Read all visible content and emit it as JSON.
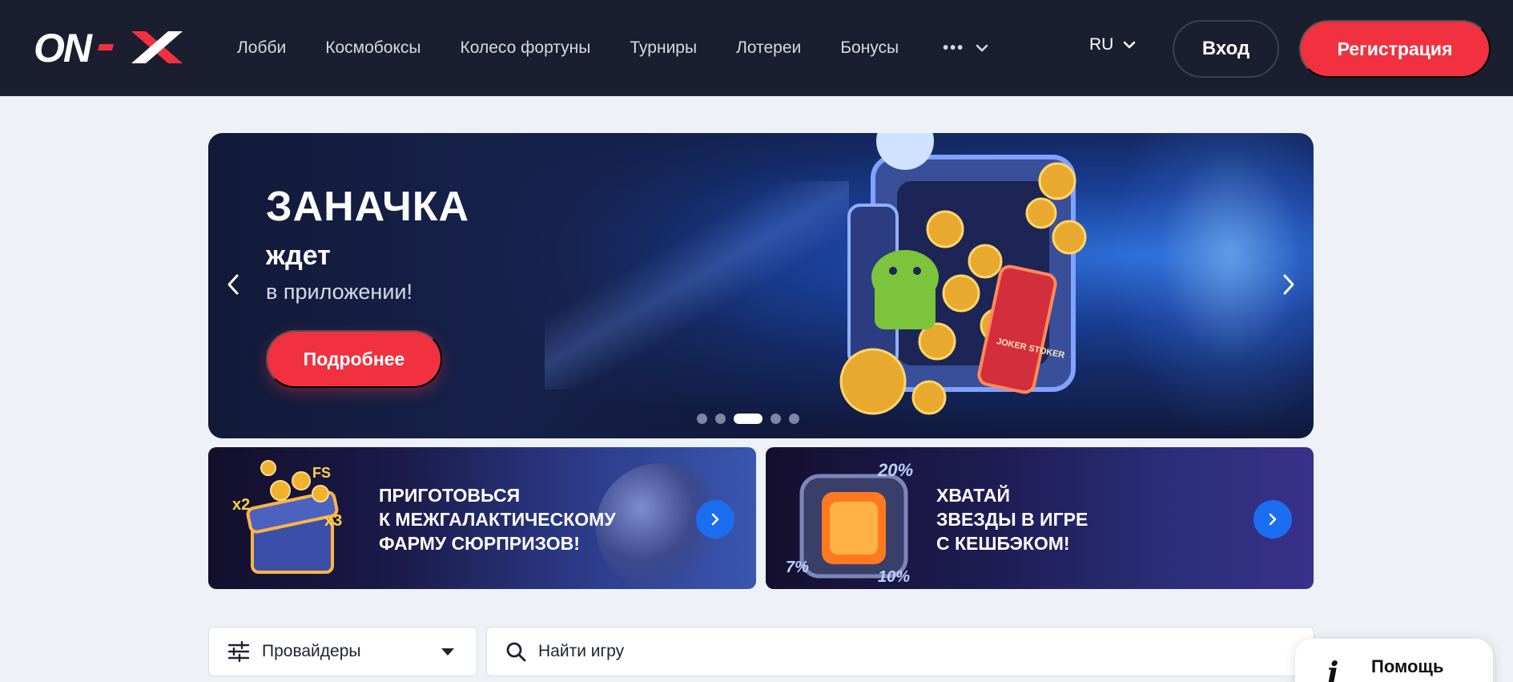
{
  "brand": {
    "logo_text": "ON-X",
    "accent": "#f1313f",
    "header_bg": "#1b1e2e"
  },
  "nav": {
    "items": [
      {
        "label": "Лобби"
      },
      {
        "label": "Космобоксы"
      },
      {
        "label": "Колесо фортуны"
      },
      {
        "label": "Турниры"
      },
      {
        "label": "Лотереи"
      },
      {
        "label": "Бонусы"
      }
    ],
    "more_icon": "more-dots-icon"
  },
  "lang": {
    "selected": "RU"
  },
  "auth": {
    "login_label": "Вход",
    "register_label": "Регистрация"
  },
  "hero": {
    "title": "ЗАНАЧКА",
    "subtitle": "ждет",
    "subtitle2": "в приложении!",
    "cta_label": "Подробнее",
    "phone_text": "JOKER STOKER",
    "slides_count": 5,
    "active_slide": 3
  },
  "promos": [
    {
      "text": "ПРИГОТОВЬСЯ К МЕЖГАЛАКТИЧЕСКОМУ ФАРМУ СЮРПРИЗОВ!",
      "lines": [
        "ПРИГОТОВЬСЯ",
        "К МЕЖГАЛАКТИЧЕСКОМУ",
        "ФАРМУ СЮРПРИЗОВ!"
      ],
      "badges": [
        "x2",
        "FS",
        "x3"
      ]
    },
    {
      "text": "ХВАТАЙ ЗВЕЗДЫ В ИГРЕ С КЕШБЭКОМ!",
      "lines": [
        "ХВАТАЙ",
        "ЗВЕЗДЫ В ИГРЕ",
        "С КЕШБЭКОМ!"
      ],
      "badges": [
        "20%",
        "7%",
        "10%"
      ]
    }
  ],
  "filters": {
    "providers_label": "Провайдеры",
    "search_placeholder": "Найти игру"
  },
  "help": {
    "icon": "info-icon",
    "label": "Помощь"
  }
}
